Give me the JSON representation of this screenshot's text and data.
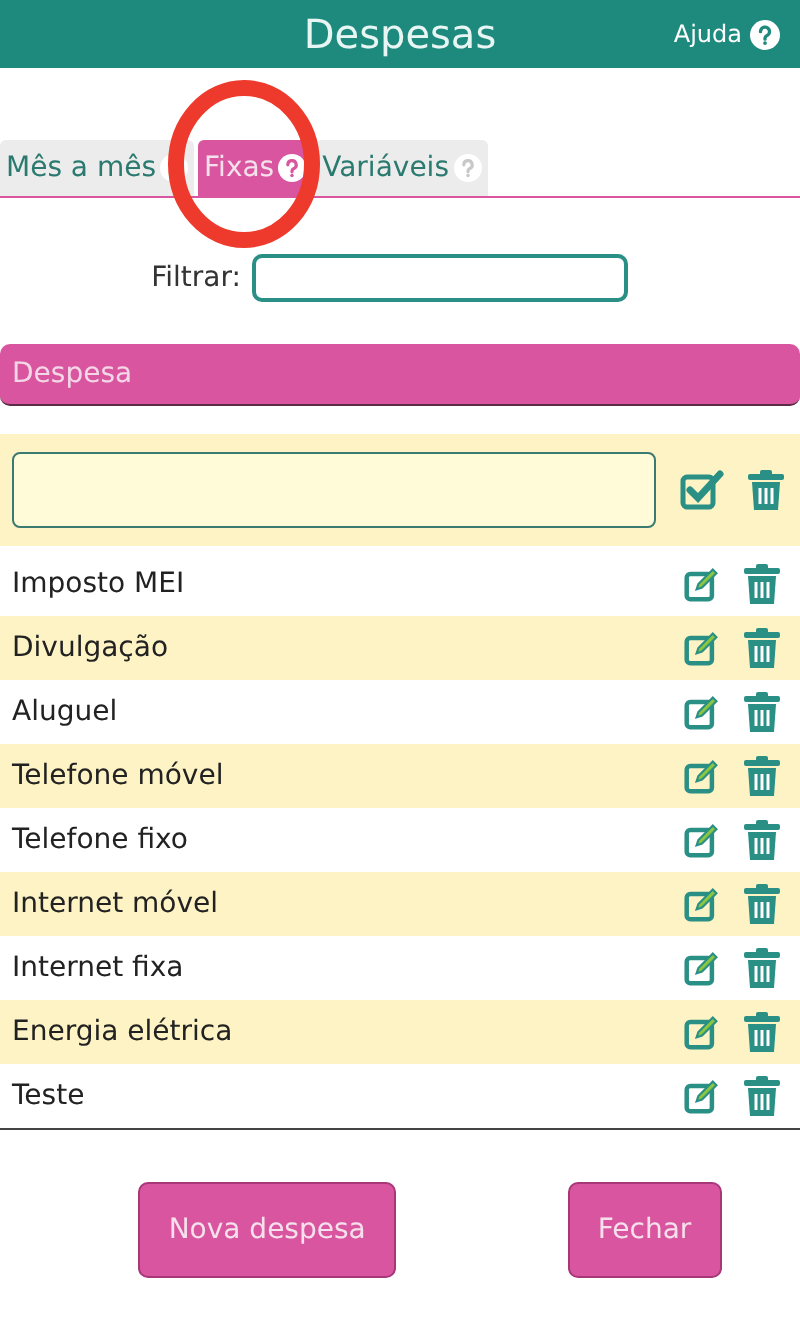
{
  "header": {
    "title": "Despesas",
    "help": "Ajuda"
  },
  "tabs": [
    {
      "label": "Mês a mês",
      "selected": false
    },
    {
      "label": "Fixas",
      "selected": true
    },
    {
      "label": "Variáveis",
      "selected": false
    }
  ],
  "filter": {
    "label": "Filtrar:"
  },
  "table": {
    "column": "Despesa",
    "rows": [
      {
        "name": "Imposto MEI"
      },
      {
        "name": "Divulgação"
      },
      {
        "name": "Aluguel"
      },
      {
        "name": "Telefone móvel"
      },
      {
        "name": "Telefone fixo"
      },
      {
        "name": "Internet móvel"
      },
      {
        "name": "Internet fixa"
      },
      {
        "name": "Energia elétrica"
      },
      {
        "name": "Teste"
      }
    ]
  },
  "buttons": [
    "Nova despesa",
    "Fechar"
  ]
}
